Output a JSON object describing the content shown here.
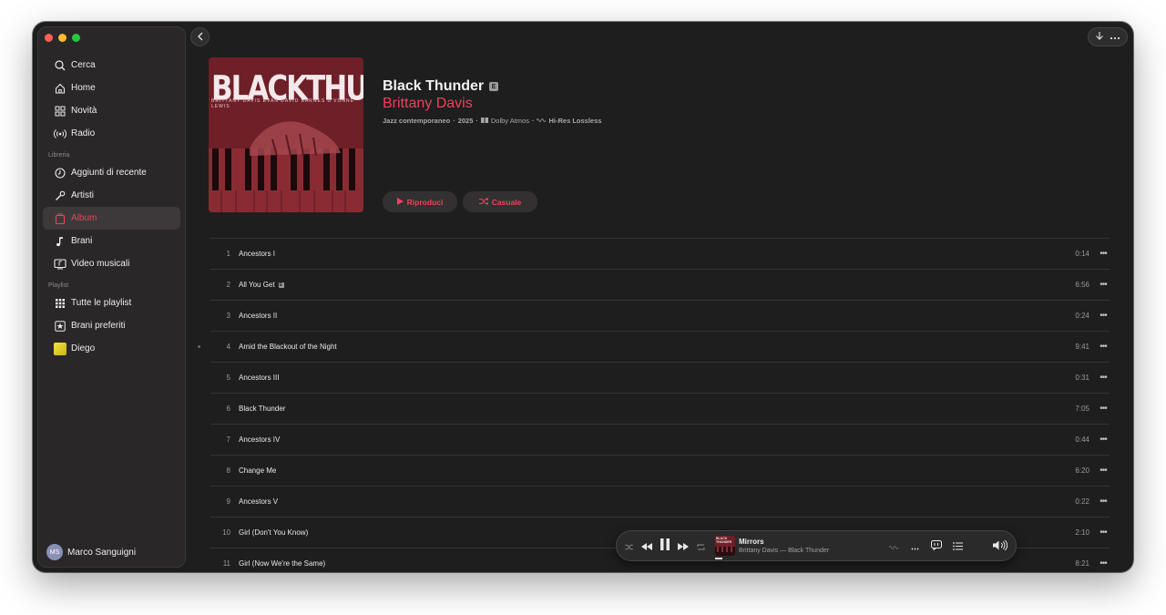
{
  "sidebar": {
    "traffic_colors": [
      "#fe5f57",
      "#febc2e",
      "#28c840"
    ],
    "nav": [
      {
        "label": "Cerca",
        "icon": "search-icon"
      },
      {
        "label": "Home",
        "icon": "home-icon"
      },
      {
        "label": "Novità",
        "icon": "grid-icon"
      },
      {
        "label": "Radio",
        "icon": "radio-icon"
      }
    ],
    "library_header": "Libreria",
    "library": [
      {
        "label": "Aggiunti di recente",
        "icon": "clock-icon"
      },
      {
        "label": "Artisti",
        "icon": "microphone-icon"
      },
      {
        "label": "Album",
        "icon": "album-icon",
        "active": true
      },
      {
        "label": "Brani",
        "icon": "music-note-icon"
      },
      {
        "label": "Video musicali",
        "icon": "video-icon"
      }
    ],
    "playlist_header": "Playlist",
    "playlists": [
      {
        "label": "Tutte le playlist",
        "icon": "playlist-grid-icon"
      },
      {
        "label": "Brani preferiti",
        "icon": "star-icon"
      },
      {
        "label": "Diego",
        "icon": "playlist-cover-icon"
      }
    ],
    "profile": {
      "initials": "MS",
      "name": "Marco Sanguigni"
    }
  },
  "album": {
    "cover_title": "BLACKTHUNDER",
    "cover_subtitle": "BRITTANY DAVIS  EVAN  DAVID BARNES  D'VONNE LEWIS",
    "title": "Black Thunder",
    "explicit": "E",
    "artist": "Brittany Davis",
    "genre": "Jazz contemporaneo",
    "year": "2025",
    "dolby": "Dolby Atmos",
    "lossless": "Hi-Res Lossless",
    "play_label": "Riproduci",
    "shuffle_label": "Casuale",
    "accent": "#f0405a"
  },
  "tracks": [
    {
      "n": "1",
      "title": "Ancestors I",
      "duration": "0:14",
      "explicit": false
    },
    {
      "n": "2",
      "title": "All You Get",
      "duration": "6:56",
      "explicit": true
    },
    {
      "n": "3",
      "title": "Ancestors II",
      "duration": "0:24",
      "explicit": false
    },
    {
      "n": "4",
      "title": "Amid the Blackout of the Night",
      "duration": "9:41",
      "explicit": false
    },
    {
      "n": "5",
      "title": "Ancestors III",
      "duration": "0:31",
      "explicit": false
    },
    {
      "n": "6",
      "title": "Black Thunder",
      "duration": "7:05",
      "explicit": false
    },
    {
      "n": "7",
      "title": "Ancestors IV",
      "duration": "0:44",
      "explicit": false
    },
    {
      "n": "8",
      "title": "Change Me",
      "duration": "6:20",
      "explicit": false
    },
    {
      "n": "9",
      "title": "Ancestors V",
      "duration": "0:22",
      "explicit": false
    },
    {
      "n": "10",
      "title": "Girl (Don't You Know)",
      "duration": "2:10",
      "explicit": false
    },
    {
      "n": "11",
      "title": "Girl (Now We're the Same)",
      "duration": "8:21",
      "explicit": false
    }
  ],
  "player": {
    "title": "Mirrors",
    "subtitle": "Brittany Davis — Black Thunder",
    "cover_text": "BLACK THUNDER"
  }
}
